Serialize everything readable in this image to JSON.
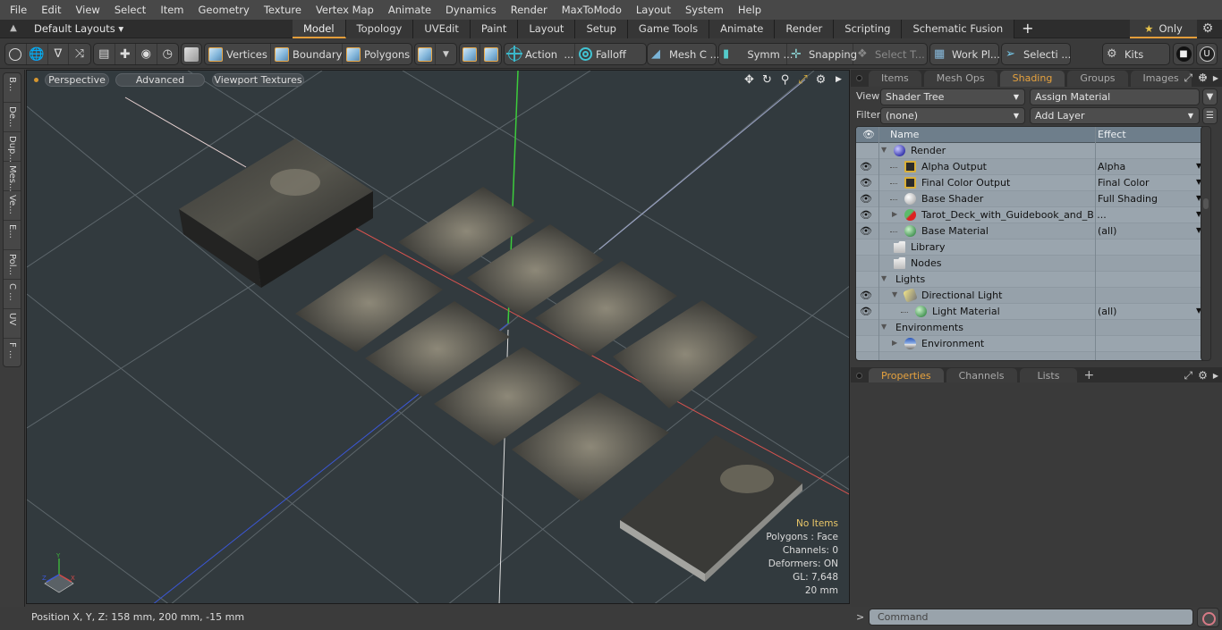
{
  "menubar": {
    "items": [
      "File",
      "Edit",
      "View",
      "Select",
      "Item",
      "Geometry",
      "Texture",
      "Vertex Map",
      "Animate",
      "Dynamics",
      "Render",
      "MaxToModo",
      "Layout",
      "System",
      "Help"
    ]
  },
  "layoutbar": {
    "layout_select": "Default Layouts ▾",
    "tabs": [
      "Model",
      "Topology",
      "UVEdit",
      "Paint",
      "Layout",
      "Setup",
      "Game Tools",
      "Animate",
      "Render",
      "Scripting",
      "Schematic Fusion"
    ],
    "active_tab": "Model",
    "add_label": "+",
    "only_label": "Only"
  },
  "toolbar": {
    "vertices": "Vertices",
    "boundary": "Boundary",
    "polygons": "Polygons",
    "action": "Action",
    "action_more": "...",
    "falloff": "Falloff",
    "mesh_c": "Mesh C ...",
    "symm": "Symm ...",
    "snapping": "Snapping",
    "select_t": "Select T...",
    "work_pl": "Work Pl...",
    "selecti": "Selecti ...",
    "kits": "Kits"
  },
  "left_strip": {
    "tabs": [
      "B...",
      "De...",
      "Dup...",
      "Mes...",
      "Ve...",
      "E...",
      "Pol...",
      "C ...",
      "UV",
      "F ..."
    ]
  },
  "viewport": {
    "perspective": "Perspective",
    "advanced": "Advanced",
    "viewport_textures": "Viewport Textures",
    "info": {
      "selection": "No Items",
      "polygons": "Polygons : Face",
      "channels": "Channels: 0",
      "deformers": "Deformers: ON",
      "gl": "GL: 7,648",
      "scale": "20 mm"
    },
    "gizmo": {
      "x": "X",
      "y": "Y",
      "z": "Z"
    },
    "colors": {
      "x_axis": "#d9534f",
      "y_axis": "#3ccc3c",
      "z_axis": "#3b57d6",
      "grid": "#6b7479",
      "background": "#323a3e"
    }
  },
  "shading_panel": {
    "tabs": [
      "Items",
      "Mesh Ops",
      "Shading",
      "Groups",
      "Images"
    ],
    "active_tab": "Shading",
    "view_label": "View",
    "view_value": "Shader Tree",
    "assign_material": "Assign Material",
    "filter_label": "Filter",
    "filter_value": "(none)",
    "add_layer": "Add Layer",
    "columns": {
      "name": "Name",
      "effect": "Effect"
    },
    "rows": [
      {
        "name": "Render",
        "effect": "",
        "icon": "sphere-blue-icon",
        "depth": 0,
        "eye": false,
        "expander": "down",
        "dropdown": false
      },
      {
        "name": "Alpha Output",
        "effect": "Alpha",
        "icon": "render-output-icon",
        "depth": 1,
        "eye": true,
        "expander": "",
        "dropdown": true
      },
      {
        "name": "Final Color Output",
        "effect": "Final Color",
        "icon": "render-output-icon",
        "depth": 1,
        "eye": true,
        "expander": "",
        "dropdown": true
      },
      {
        "name": "Base Shader",
        "effect": "Full Shading",
        "icon": "sphere-white-icon",
        "depth": 1,
        "eye": true,
        "expander": "",
        "dropdown": true
      },
      {
        "name": "Tarot_Deck_with_Guidebook_and_B ...",
        "effect": "",
        "icon": "material-group-icon",
        "depth": 1,
        "eye": true,
        "expander": "right",
        "dropdown": true
      },
      {
        "name": "Base Material",
        "effect": "(all)",
        "icon": "sphere-green-icon",
        "depth": 1,
        "eye": true,
        "expander": "",
        "dropdown": true
      },
      {
        "name": "Library",
        "effect": "",
        "icon": "folder-icon",
        "depth": 0,
        "eye": false,
        "expander": "",
        "dropdown": false
      },
      {
        "name": "Nodes",
        "effect": "",
        "icon": "folder-icon",
        "depth": 0,
        "eye": false,
        "expander": "",
        "dropdown": false
      },
      {
        "name": "Lights",
        "effect": "",
        "icon": "",
        "depth": 0,
        "eye": false,
        "expander": "down",
        "dropdown": false
      },
      {
        "name": "Directional Light",
        "effect": "",
        "icon": "directional-light-icon",
        "depth": 1,
        "eye": true,
        "expander": "down",
        "dropdown": false
      },
      {
        "name": "Light Material",
        "effect": "(all)",
        "icon": "sphere-green-icon",
        "depth": 2,
        "eye": true,
        "expander": "",
        "dropdown": true
      },
      {
        "name": "Environments",
        "effect": "",
        "icon": "",
        "depth": 0,
        "eye": false,
        "expander": "down",
        "dropdown": false
      },
      {
        "name": "Environment",
        "effect": "",
        "icon": "environment-icon",
        "depth": 1,
        "eye": false,
        "expander": "right",
        "dropdown": false
      }
    ]
  },
  "properties_panel": {
    "tabs": [
      "Properties",
      "Channels",
      "Lists"
    ],
    "active_tab": "Properties"
  },
  "statusbar": {
    "position_text": "Position X, Y, Z:   158 mm, 200 mm, -15 mm"
  },
  "command": {
    "prompt": ">",
    "placeholder": "Command"
  },
  "accent_color": "#e39d3a"
}
